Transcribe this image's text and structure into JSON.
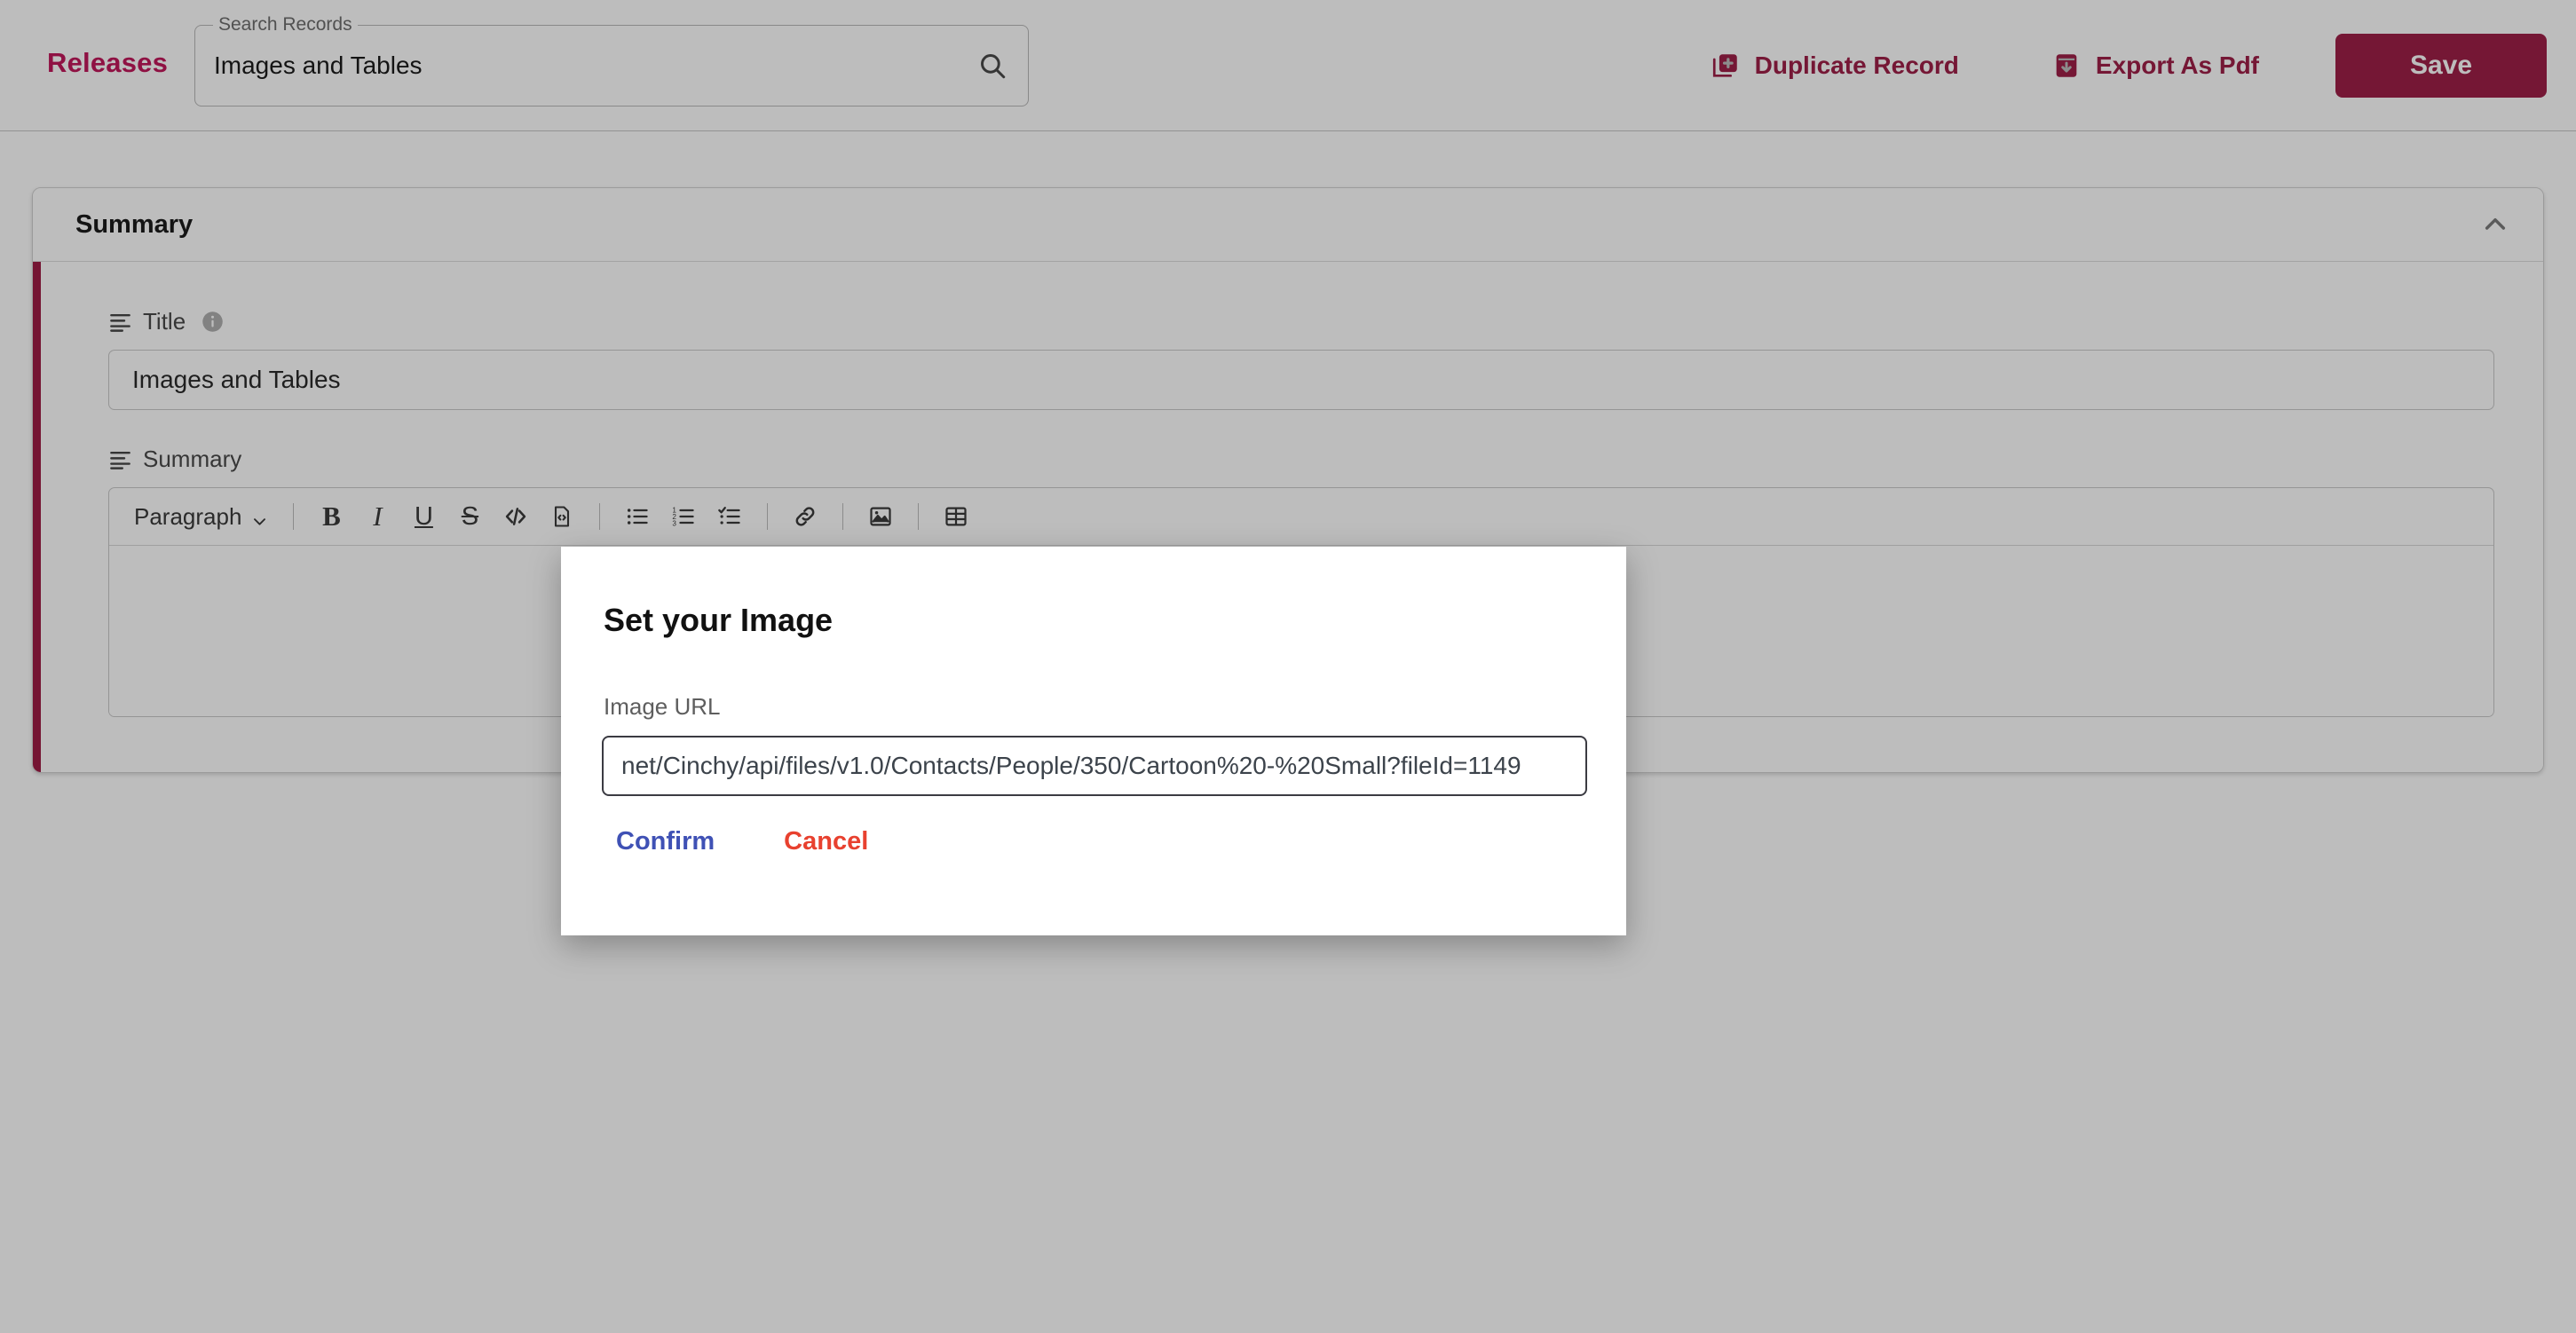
{
  "header": {
    "brand": "Releases",
    "search": {
      "label": "Search Records",
      "value": "Images and Tables",
      "placeholder": "Search Records",
      "icon": "search-icon"
    },
    "actions": {
      "duplicate_label": "Duplicate Record",
      "duplicate_icon": "duplicate-record-icon",
      "export_label": "Export As Pdf",
      "export_icon": "export-pdf-icon",
      "save_label": "Save"
    }
  },
  "card": {
    "title": "Summary",
    "collapse_icon": "chevron-up-icon",
    "accent_color": "#9e1b46",
    "fields": {
      "title": {
        "label": "Title",
        "value": "Images and Tables",
        "placeholder": "",
        "icon": "text-lines-icon",
        "info_icon": "info-icon"
      },
      "summary": {
        "label": "Summary",
        "icon": "text-lines-icon",
        "content": ""
      }
    }
  },
  "editor_toolbar": {
    "paragraph_label": "Paragraph",
    "paragraph_caret": "chevron-down-icon",
    "buttons": [
      {
        "name": "bold-button",
        "glyph": "B",
        "kind": "text"
      },
      {
        "name": "italic-button",
        "glyph": "I",
        "kind": "text"
      },
      {
        "name": "underline-button",
        "glyph": "U",
        "kind": "text"
      },
      {
        "name": "strikethrough-button",
        "glyph": "S",
        "kind": "text"
      },
      {
        "name": "code-button",
        "glyph": "</>",
        "kind": "icon"
      },
      {
        "name": "code-block-button",
        "glyph": "",
        "kind": "icon"
      },
      {
        "name": "bullet-list-button",
        "glyph": "",
        "kind": "icon"
      },
      {
        "name": "numbered-list-button",
        "glyph": "",
        "kind": "icon"
      },
      {
        "name": "todo-list-button",
        "glyph": "",
        "kind": "icon"
      },
      {
        "name": "link-button",
        "glyph": "",
        "kind": "icon"
      },
      {
        "name": "image-button",
        "glyph": "",
        "kind": "icon"
      },
      {
        "name": "table-button",
        "glyph": "",
        "kind": "icon"
      }
    ]
  },
  "dialog": {
    "title": "Set your Image",
    "url_label": "Image URL",
    "url_value": "net/Cinchy/api/files/v1.0/Contacts/People/350/Cartoon%20-%20Small?fileId=1149",
    "url_placeholder": "",
    "confirm_label": "Confirm",
    "cancel_label": "Cancel",
    "confirm_color": "#3f51b5",
    "cancel_color": "#e8412f"
  }
}
